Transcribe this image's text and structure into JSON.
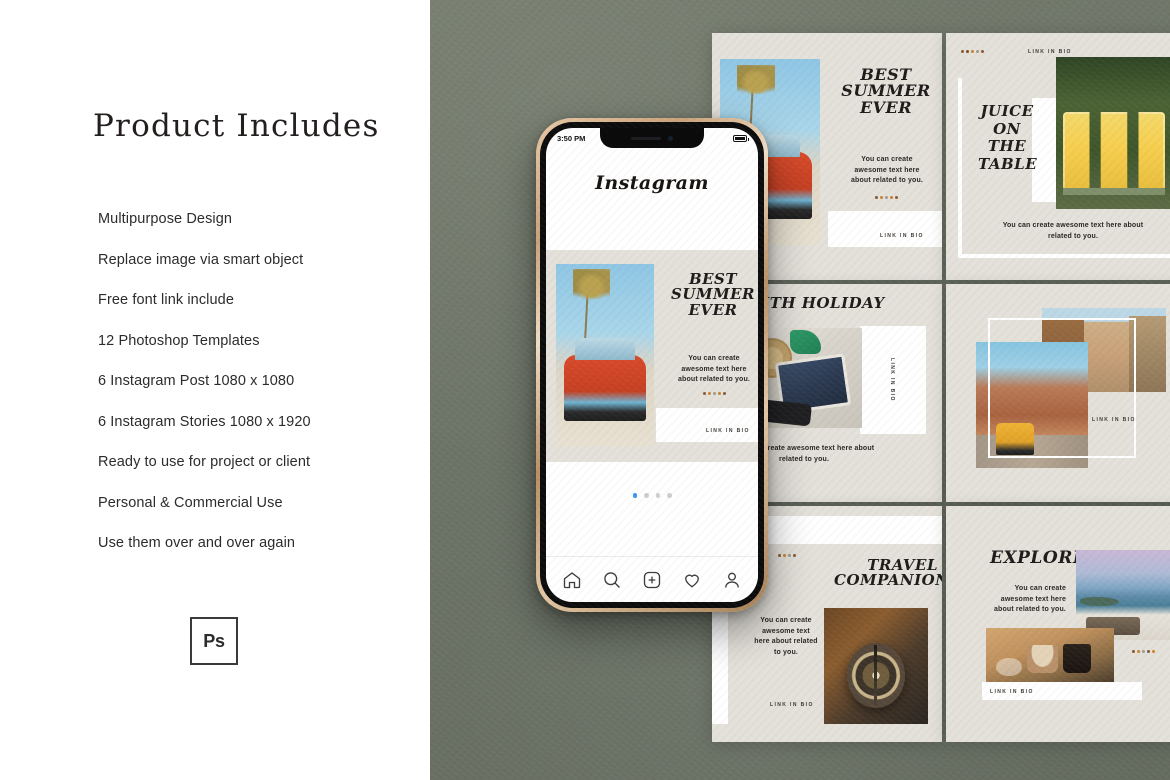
{
  "left": {
    "title": "Product Includes",
    "features": [
      "Multipurpose Design",
      "Replace image via smart object",
      "Free font link include",
      "12 Photoshop Templates",
      "6 Instagram Post 1080 x 1080",
      "6 Instagram Stories 1080 x 1920",
      "Ready to use for project or client",
      "Personal & Commercial Use",
      "Use them over and over again"
    ],
    "badge": {
      "label": "Ps",
      "name": "photoshop-badge"
    }
  },
  "phone": {
    "status": {
      "time": "3:50 PM",
      "battery_icon": "battery-icon"
    },
    "app_logo": "Instagram",
    "post": {
      "headline_line1": "BEST",
      "headline_line2": "SUMMER",
      "headline_line3": "EVER",
      "body": "You can create awesome text here about related to you.",
      "link": "LINK IN BIO"
    },
    "carousel_dots": {
      "count": 4,
      "active_index": 0,
      "active_color": "#3897f0"
    },
    "tabbar": [
      {
        "name": "home-icon",
        "label": "Home"
      },
      {
        "name": "search-icon",
        "label": "Search"
      },
      {
        "name": "add-post-icon",
        "label": "Add"
      },
      {
        "name": "heart-icon",
        "label": "Activity"
      },
      {
        "name": "profile-icon",
        "label": "Profile"
      }
    ]
  },
  "templates": [
    {
      "id": "card-best-summer-ever",
      "title_lines": [
        "BEST",
        "SUMMER",
        "EVER"
      ],
      "body": "You can create awesome text here about related to you.",
      "link": "LINK IN BIO",
      "photo": "beach-car-palm"
    },
    {
      "id": "card-juice-on-the-table",
      "title_lines": [
        "JUICE",
        "ON",
        "THE",
        "TABLE"
      ],
      "body": "You can create awesome text here about related to you.",
      "link": "LINK IN BIO",
      "photo": "lemonade-jars"
    },
    {
      "id": "card-month-holiday",
      "title_lines": [
        "O-MONTH HOLIDAY"
      ],
      "body": "You can create awesome text here about related to you.",
      "link": "LINK IN BIO",
      "photo": "packed-suitcase"
    },
    {
      "id": "card-travel-frames",
      "title_lines": [],
      "body": "",
      "link": "LINK IN BIO",
      "photo": "canyon-van-street"
    },
    {
      "id": "card-travel-companion",
      "title_lines": [
        "TRAVEL",
        "COMPANION"
      ],
      "body": "You can create awesome text here about related to you.",
      "link": "LINK IN BIO",
      "photo": "vintage-compass"
    },
    {
      "id": "card-explore",
      "title_lines": [
        "EXPLORE"
      ],
      "body": "You can create awesome text here about related to you.",
      "link": "LINK IN BIO",
      "photo": "sea-view-coffee"
    }
  ],
  "colors": {
    "background_concrete": "#6c7366",
    "card_beige": "#e4e1da",
    "text_dark": "#1d1b19",
    "accent_dot_brown": "#8a5a32",
    "accent_dot_orange": "#c9822f",
    "accent_dot_grey": "#9b9b93",
    "phone_frame_gold": "#c9a279",
    "instagram_blue": "#3897f0"
  }
}
